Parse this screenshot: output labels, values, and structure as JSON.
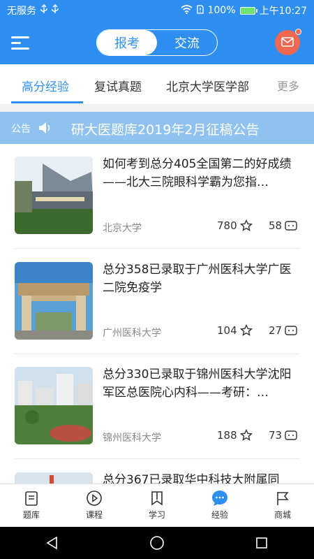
{
  "status_bar": {
    "carrier": "无服务",
    "battery": "100%",
    "time": "上午10:27"
  },
  "header": {
    "segments": [
      "报考",
      "交流"
    ],
    "active_segment": "报考",
    "accent": "#2f8ff0",
    "mail_color": "#f0684f"
  },
  "tabs": {
    "items": [
      "高分经验",
      "复试真题",
      "北京大学医学部"
    ],
    "active": "高分经验",
    "more_label": "更多"
  },
  "notice": {
    "label": "公告",
    "text": "研大医题库2019年2月征稿公告"
  },
  "articles": [
    {
      "title": "如何考到总分405全国第二的好成绩——北大三院眼科学霸为您指…",
      "school": "北京大学",
      "stars": "780",
      "comments": "58"
    },
    {
      "title": "总分358已录取于广州医科大学广医二院免疫学",
      "school": "广州医科大学",
      "stars": "104",
      "comments": "27"
    },
    {
      "title": "总分330已录取于锦州医科大学沈阳军区总医院心内科——考研：…",
      "school": "锦州医科大学",
      "stars": "188",
      "comments": "73"
    },
    {
      "title": "总分367已录取华中科技大附属同",
      "school": "",
      "stars": "",
      "comments": ""
    }
  ],
  "bottom_nav": {
    "items": [
      {
        "label": "题库",
        "icon": "document-icon"
      },
      {
        "label": "课程",
        "icon": "play-icon"
      },
      {
        "label": "学习",
        "icon": "bookmark-icon"
      },
      {
        "label": "经验",
        "icon": "chat-bubble-icon"
      },
      {
        "label": "商城",
        "icon": "flag-icon"
      }
    ],
    "active": "经验"
  }
}
